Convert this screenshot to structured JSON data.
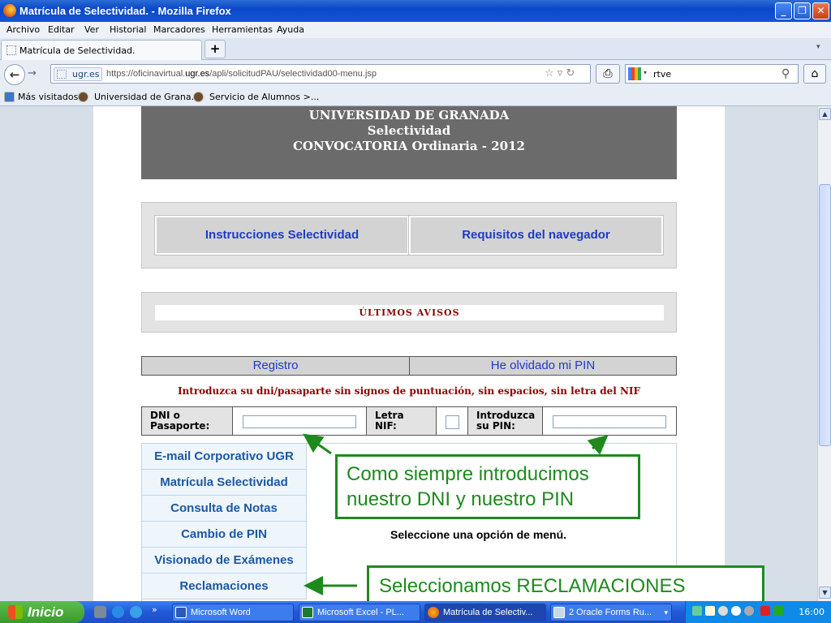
{
  "window": {
    "title": "Matrícula de Selectividad. - Mozilla Firefox"
  },
  "menu": [
    "Archivo",
    "Editar",
    "Ver",
    "Historial",
    "Marcadores",
    "Herramientas",
    "Ayuda"
  ],
  "tab": {
    "title": "Matrícula de Selectividad.",
    "new_tab": "+"
  },
  "nav": {
    "site_badge": "ugr.es",
    "url_prefix": "https://oficinavirtual.",
    "url_domain": "ugr.es",
    "url_rest": "/apli/solicitudPAU/selectividad00-menu.jsp",
    "search_value": "rtve"
  },
  "bookmarks": [
    "Más visitados",
    "Universidad de Grana...",
    "Servicio de Alumnos >..."
  ],
  "banner": {
    "line1": "UNIVERSIDAD DE GRANADA",
    "line2": "Selectividad",
    "line3": "CONVOCATORIA Ordinaria - 2012"
  },
  "links": {
    "instrucciones": "Instrucciones Selectividad",
    "requisitos": "Requisitos del navegador"
  },
  "avisos": "ÚLTIMOS AVISOS",
  "access_tabs": {
    "registro": "Registro",
    "olvido": "He olvidado mi PIN"
  },
  "instruction": "Introduzca su dni/pasaparte sin signos de puntuación, sin espacios, sin letra del NIF",
  "form": {
    "dni_label_1": "DNI o",
    "dni_label_2": "Pasaporte:",
    "letra_label_1": "Letra",
    "letra_label_2": "NIF:",
    "pin_label_1": "Introduzca",
    "pin_label_2": "su PIN:",
    "dni_value": "",
    "letra_value": "",
    "pin_value": ""
  },
  "side_menu": [
    "E-mail Corporativo UGR",
    "Matrícula Selectividad",
    "Consulta de Notas",
    "Cambio de PIN",
    "Visionado de Exámenes",
    "Reclamaciones"
  ],
  "select_prompt": "Seleccione una opción de menú.",
  "annotations": {
    "callout1_line1": "Como siempre introducimos",
    "callout1_line2": "nuestro DNI y nuestro PIN",
    "callout2": "Seleccionamos RECLAMACIONES",
    "color": "#1e8a1e"
  },
  "taskbar": {
    "start": "Inicio",
    "items": [
      "Microsoft Word",
      "Microsoft Excel - PL...",
      "Matrícula de Selectiv...",
      "2 Oracle Forms Ru..."
    ],
    "clock": "16:00"
  }
}
